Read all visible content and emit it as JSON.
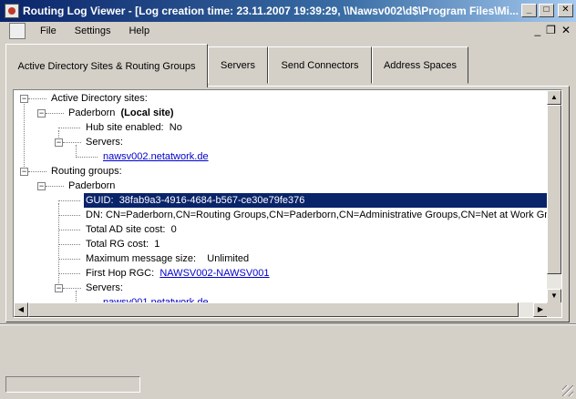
{
  "window": {
    "title": "Routing Log Viewer - [Log creation time: 23.11.2007 19:39:29, \\\\Nawsv002\\d$\\Program Files\\Mi...",
    "minimize_icon": "minimize-icon",
    "maximize_icon": "maximize-icon",
    "close_icon": "close-icon"
  },
  "menu": {
    "items": [
      "File",
      "Settings",
      "Help"
    ]
  },
  "tabs": [
    {
      "label": "Active Directory Sites & Routing Groups",
      "active": true
    },
    {
      "label": "Servers"
    },
    {
      "label": "Send Connectors"
    },
    {
      "label": "Address Spaces"
    }
  ],
  "tree": {
    "ad_sites": "Active Directory sites:",
    "site_name": "Paderborn",
    "site_local": "(Local site)",
    "hub_enabled_label": "Hub site enabled:",
    "hub_enabled_value": "No",
    "servers_label": "Servers:",
    "site_server": "nawsv002.netatwork.de",
    "routing_groups": "Routing groups:",
    "rg_name": "Paderborn",
    "guid_label": "GUID:",
    "guid_value": "38fab9a3-4916-4684-b567-ce30e79fe376",
    "dn": "DN: CN=Paderborn,CN=Routing Groups,CN=Paderborn,CN=Administrative Groups,CN=Net at Work Gm",
    "ad_cost_label": "Total AD site cost:",
    "ad_cost_value": "0",
    "rg_cost_label": "Total RG cost:",
    "rg_cost_value": "1",
    "max_msg_label": "Maximum message size:",
    "max_msg_value": "Unlimited",
    "first_hop_label": "First Hop RGC:",
    "first_hop_value": "NAWSV002-NAWSV001",
    "rg_servers_label": "Servers:",
    "rg_server": "nawsv001.netatwork.de"
  }
}
